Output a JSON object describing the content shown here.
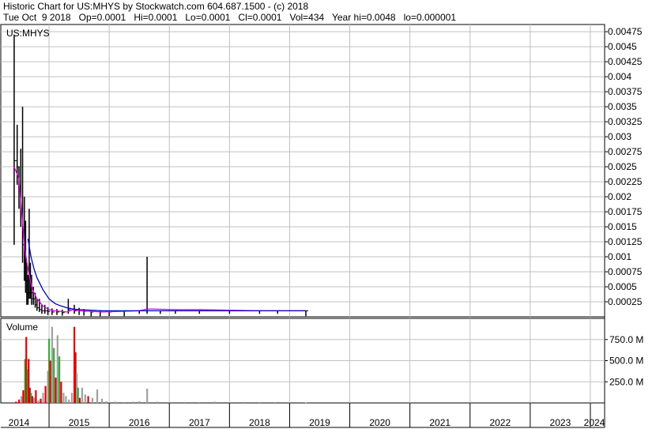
{
  "header": {
    "title": "Historic Chart for US:MHYS by Stockwatch.com 604.687.1500 - (c) 2018",
    "quote": "Tue Oct  9 2018   Op=0.0001   Hi=0.0001   Lo=0.0001   Cl=0.0001   Vol=434   Year hi=0.0048   lo=0.000001"
  },
  "colors": {
    "price_bar": "#000000",
    "ma_short": "#e000e0",
    "ma_long": "#0000c0",
    "volume_up": "#3aa83a",
    "volume_down": "#e00000",
    "volume_flat": "#a0a0a0",
    "grid": "#c0c0c0"
  },
  "chart_data": [
    {
      "type": "line",
      "label": "US:MHYS",
      "y_ticks": [
        "0.00475",
        "0.0045",
        "0.00425",
        "0.004",
        "0.00375",
        "0.0035",
        "0.00325",
        "0.003",
        "0.00275",
        "0.0025",
        "0.00225",
        "0.002",
        "0.00175",
        "0.0015",
        "0.00125",
        "0.001",
        "0.00075",
        "0.0005",
        "0.00025"
      ],
      "ylim": [
        0,
        0.00487
      ],
      "x_ticks": [
        "2014",
        "2015",
        "2016",
        "2017",
        "2018",
        "2019",
        "2020",
        "2021",
        "2022",
        "2023",
        "2024"
      ],
      "grid": true,
      "series": [
        {
          "style": "ohlc-bars",
          "x": [
            2013.92,
            2013.97,
            2014.0,
            2014.03,
            2014.06,
            2014.09,
            2014.11,
            2014.13,
            2014.15,
            2014.17,
            2014.19,
            2014.21,
            2014.24,
            2014.27,
            2014.3,
            2014.34,
            2014.38,
            2014.43,
            2014.48,
            2014.55,
            2014.63,
            2014.72,
            2014.82,
            2014.92,
            2015.0,
            2015.08,
            2015.2,
            2015.35,
            2015.5,
            2015.75,
            2016.0,
            2016.13,
            2016.35,
            2016.6,
            2017.0,
            2017.5,
            2018.0,
            2018.3,
            2018.77
          ],
          "high": [
            0.0047,
            0.0032,
            0.0025,
            0.0028,
            0.0035,
            0.002,
            0.0016,
            0.0009,
            0.0007,
            0.0018,
            0.0009,
            0.0007,
            0.0005,
            0.0004,
            0.0003,
            0.0003,
            0.0002,
            0.0002,
            0.00016,
            0.00014,
            0.00013,
            0.00012,
            0.0003,
            0.0002,
            0.00015,
            0.00013,
            0.0001,
            0.0001,
            0.0001,
            0.0001,
            0.0001,
            0.001,
            0.0001,
            0.0001,
            0.0001,
            0.0001,
            0.0001,
            0.0001,
            0.0001
          ],
          "low": [
            0.0012,
            0.0022,
            0.0018,
            0.0015,
            0.0009,
            0.0006,
            0.0004,
            0.0002,
            0.0002,
            0.0003,
            0.0003,
            0.0002,
            0.0002,
            0.00015,
            0.0001,
            8e-05,
            5e-05,
            5e-05,
            3e-05,
            3e-05,
            3e-05,
            2e-05,
            5e-05,
            5e-05,
            3e-05,
            2e-05,
            1e-05,
            1e-05,
            1e-05,
            1e-05,
            5e-05,
            5e-05,
            5e-05,
            5e-05,
            5e-05,
            5e-05,
            5e-05,
            5e-05,
            1e-05
          ],
          "close": [
            0.0026,
            0.0025,
            0.0021,
            0.0018,
            0.0012,
            0.0009,
            0.0006,
            0.0004,
            0.0004,
            0.0006,
            0.0004,
            0.0003,
            0.0003,
            0.0002,
            0.00015,
            0.00012,
            0.0001,
            0.0001,
            9e-05,
            8e-05,
            8e-05,
            7e-05,
            0.00012,
            0.0001,
            0.0001,
            9e-05,
            8e-05,
            8e-05,
            8e-05,
            0.0001,
            0.0001,
            0.0001,
            0.0001,
            0.0001,
            0.0001,
            0.0001,
            0.0001,
            0.0001,
            0.0001
          ]
        },
        {
          "style": "moving-average-short",
          "x": [
            2013.92,
            2014.0,
            2014.05,
            2014.1,
            2014.15,
            2014.2,
            2014.25,
            2014.3,
            2014.4,
            2014.5,
            2014.6,
            2014.7,
            2014.8,
            2014.9,
            2015.0,
            2015.2,
            2015.4,
            2016.0,
            2016.13,
            2016.2,
            2016.6,
            2017.0,
            2017.5,
            2018.0,
            2018.3,
            2018.77
          ],
          "y": [
            0.0025,
            0.0023,
            0.0017,
            0.0011,
            0.0008,
            0.00055,
            0.0004,
            0.0003,
            0.00018,
            0.00012,
            0.0001,
            9e-05,
            8e-05,
            0.00012,
            0.0001,
            9e-05,
            8e-05,
            0.0001,
            0.00013,
            0.00013,
            0.00012,
            0.00012,
            0.00011,
            0.0001,
            0.0001,
            0.0001
          ]
        },
        {
          "style": "moving-average-long",
          "x": [
            2014.15,
            2014.2,
            2014.25,
            2014.3,
            2014.4,
            2014.5,
            2014.6,
            2014.7,
            2014.8,
            2014.9,
            2015.0,
            2015.2,
            2015.4,
            2016.0,
            2017.0,
            2018.0,
            2018.77
          ],
          "y": [
            0.0013,
            0.001,
            0.0008,
            0.00065,
            0.00045,
            0.0003,
            0.00022,
            0.00018,
            0.00015,
            0.00013,
            0.00012,
            0.00011,
            0.0001,
            0.0001,
            0.0001,
            0.0001,
            0.0001
          ]
        }
      ]
    },
    {
      "type": "bar",
      "label": "Volume",
      "y_ticks": [
        "750.0 M",
        "500.0 M",
        "250.0 M"
      ],
      "ylim": [
        0,
        1000
      ],
      "unit": "M",
      "grid": true,
      "bars": [
        {
          "x": 2013.95,
          "value": 15,
          "dir": "down"
        },
        {
          "x": 2014.0,
          "value": 40,
          "dir": "down"
        },
        {
          "x": 2014.04,
          "value": 80,
          "dir": "flat"
        },
        {
          "x": 2014.07,
          "value": 150,
          "dir": "down"
        },
        {
          "x": 2014.1,
          "value": 520,
          "dir": "up"
        },
        {
          "x": 2014.12,
          "value": 780,
          "dir": "down"
        },
        {
          "x": 2014.14,
          "value": 400,
          "dir": "up"
        },
        {
          "x": 2014.16,
          "value": 520,
          "dir": "down"
        },
        {
          "x": 2014.18,
          "value": 180,
          "dir": "down"
        },
        {
          "x": 2014.2,
          "value": 120,
          "dir": "up"
        },
        {
          "x": 2014.22,
          "value": 80,
          "dir": "down"
        },
        {
          "x": 2014.25,
          "value": 60,
          "dir": "flat"
        },
        {
          "x": 2014.28,
          "value": 150,
          "dir": "down"
        },
        {
          "x": 2014.32,
          "value": 30,
          "dir": "flat"
        },
        {
          "x": 2014.36,
          "value": 50,
          "dir": "down"
        },
        {
          "x": 2014.4,
          "value": 120,
          "dir": "flat"
        },
        {
          "x": 2014.44,
          "value": 200,
          "dir": "down"
        },
        {
          "x": 2014.48,
          "value": 380,
          "dir": "flat"
        },
        {
          "x": 2014.5,
          "value": 760,
          "dir": "up"
        },
        {
          "x": 2014.52,
          "value": 500,
          "dir": "down"
        },
        {
          "x": 2014.55,
          "value": 900,
          "dir": "flat"
        },
        {
          "x": 2014.58,
          "value": 650,
          "dir": "up"
        },
        {
          "x": 2014.61,
          "value": 300,
          "dir": "down"
        },
        {
          "x": 2014.64,
          "value": 800,
          "dir": "flat"
        },
        {
          "x": 2014.67,
          "value": 550,
          "dir": "up"
        },
        {
          "x": 2014.7,
          "value": 250,
          "dir": "down"
        },
        {
          "x": 2014.74,
          "value": 120,
          "dir": "flat"
        },
        {
          "x": 2014.78,
          "value": 80,
          "dir": "flat"
        },
        {
          "x": 2014.83,
          "value": 40,
          "dir": "flat"
        },
        {
          "x": 2014.88,
          "value": 120,
          "dir": "flat"
        },
        {
          "x": 2014.92,
          "value": 900,
          "dir": "down"
        },
        {
          "x": 2014.94,
          "value": 600,
          "dir": "down"
        },
        {
          "x": 2014.96,
          "value": 350,
          "dir": "flat"
        },
        {
          "x": 2014.98,
          "value": 180,
          "dir": "up"
        },
        {
          "x": 2015.01,
          "value": 60,
          "dir": "down"
        },
        {
          "x": 2015.05,
          "value": 180,
          "dir": "flat"
        },
        {
          "x": 2015.1,
          "value": 100,
          "dir": "flat"
        },
        {
          "x": 2015.15,
          "value": 80,
          "dir": "down"
        },
        {
          "x": 2015.22,
          "value": 60,
          "dir": "flat"
        },
        {
          "x": 2015.3,
          "value": 160,
          "dir": "flat"
        },
        {
          "x": 2015.38,
          "value": 50,
          "dir": "flat"
        },
        {
          "x": 2015.45,
          "value": 20,
          "dir": "flat"
        },
        {
          "x": 2015.6,
          "value": 15,
          "dir": "flat"
        },
        {
          "x": 2015.75,
          "value": 10,
          "dir": "flat"
        },
        {
          "x": 2015.9,
          "value": 15,
          "dir": "flat"
        },
        {
          "x": 2016.0,
          "value": 20,
          "dir": "flat"
        },
        {
          "x": 2016.13,
          "value": 170,
          "dir": "flat"
        },
        {
          "x": 2016.3,
          "value": 15,
          "dir": "flat"
        },
        {
          "x": 2016.5,
          "value": 10,
          "dir": "flat"
        },
        {
          "x": 2016.75,
          "value": 12,
          "dir": "flat"
        },
        {
          "x": 2017.0,
          "value": 10,
          "dir": "flat"
        },
        {
          "x": 2017.25,
          "value": 15,
          "dir": "flat"
        },
        {
          "x": 2017.5,
          "value": 10,
          "dir": "flat"
        },
        {
          "x": 2017.75,
          "value": 12,
          "dir": "flat"
        },
        {
          "x": 2018.0,
          "value": 8,
          "dir": "flat"
        },
        {
          "x": 2018.25,
          "value": 10,
          "dir": "flat"
        },
        {
          "x": 2018.5,
          "value": 8,
          "dir": "flat"
        },
        {
          "x": 2018.77,
          "value": 5,
          "dir": "flat"
        }
      ]
    }
  ]
}
